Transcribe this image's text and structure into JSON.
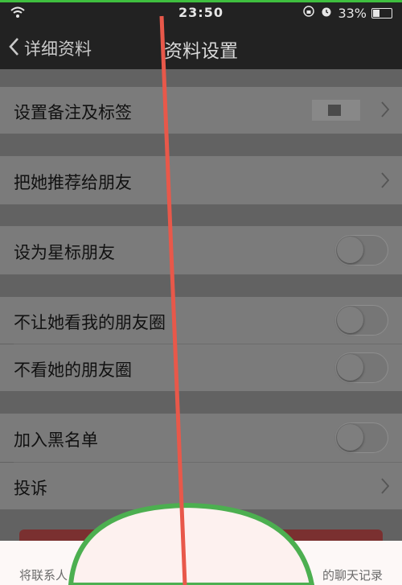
{
  "status_bar": {
    "time": "23:50",
    "battery": "33%",
    "battery_level": 0.33
  },
  "nav": {
    "back_label": "详细资料",
    "title": "资料设置"
  },
  "rows": {
    "remark": {
      "label": "设置备注及标签"
    },
    "recommend": {
      "label": "把她推荐给朋友"
    },
    "star": {
      "label": "设为星标朋友",
      "on": false
    },
    "block_moments": {
      "label": "不让她看我的朋友圈",
      "on": false
    },
    "hide_moments": {
      "label": "不看她的朋友圈",
      "on": false
    },
    "blacklist": {
      "label": "加入黑名单",
      "on": false
    },
    "complain": {
      "label": "投诉"
    }
  },
  "sheet": {
    "text_left": "将联系人",
    "text_right": "的聊天记录"
  },
  "colors": {
    "annotation_line": "#e8584a",
    "annotation_circle": "#4caf50"
  }
}
